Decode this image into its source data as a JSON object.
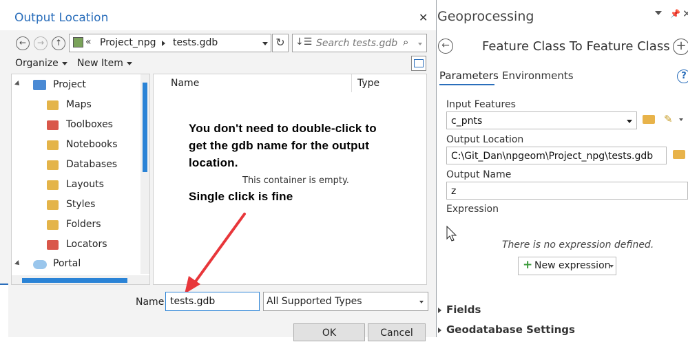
{
  "dialog": {
    "title": "Output Location",
    "close": "✕",
    "breadcrumb": {
      "overflow": "«",
      "items": [
        "Project_npg",
        "tests.gdb"
      ]
    },
    "search_placeholder": "Search tests.gdb",
    "toolbar": {
      "organize": "Organize",
      "new_item": "New Item"
    },
    "sidebar": [
      {
        "label": "Project",
        "icon": "project-icon",
        "level": 0
      },
      {
        "label": "Maps",
        "icon": "map-folder-icon",
        "level": 1
      },
      {
        "label": "Toolboxes",
        "icon": "toolbox-folder-icon",
        "level": 1
      },
      {
        "label": "Notebooks",
        "icon": "notebook-folder-icon",
        "level": 1
      },
      {
        "label": "Databases",
        "icon": "database-folder-icon",
        "level": 1
      },
      {
        "label": "Layouts",
        "icon": "layout-folder-icon",
        "level": 1
      },
      {
        "label": "Styles",
        "icon": "style-folder-icon",
        "level": 1
      },
      {
        "label": "Folders",
        "icon": "folder-icon",
        "level": 1
      },
      {
        "label": "Locators",
        "icon": "locator-folder-icon",
        "level": 1
      },
      {
        "label": "Portal",
        "icon": "portal-cloud-icon",
        "level": 0
      }
    ],
    "columns": {
      "name": "Name",
      "type": "Type"
    },
    "empty_message": "This container is empty.",
    "annotation": {
      "line1": "You don't need to double-click to",
      "line2": "get the gdb name for the output",
      "line3": "location.",
      "line4": "Single click is fine",
      "arrow_color": "#e8363a"
    },
    "footer": {
      "name_label": "Name",
      "name_value": "tests.gdb",
      "type_filter": "All Supported Types",
      "ok": "OK",
      "cancel": "Cancel"
    }
  },
  "geoprocessing": {
    "title": "Geoprocessing",
    "tool_title": "Feature Class To Feature Class",
    "tabs": [
      "Parameters",
      "Environments"
    ],
    "help": "?",
    "input_features_label": "Input Features",
    "input_features_value": "c_pnts",
    "output_location_label": "Output Location",
    "output_location_value": "C:\\Git_Dan\\npgeom\\Project_npg\\tests.gdb",
    "output_name_label": "Output Name",
    "output_name_value": "z",
    "expression_label": "Expression",
    "no_expression": "There is no expression defined.",
    "new_expression": "New expression",
    "sections": [
      "Fields",
      "Geodatabase Settings"
    ],
    "accent_color": "#2a6ebb"
  }
}
